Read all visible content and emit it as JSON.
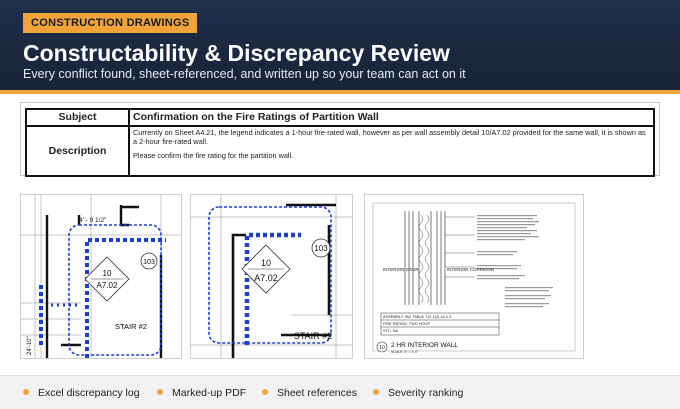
{
  "header": {
    "tag": "CONSTRUCTION DRAWINGS",
    "title": "Constructability & Discrepancy Review",
    "subtitle": "Every conflict found, sheet-referenced, and written up so your team can act on it"
  },
  "discrepancy": {
    "subject_label": "Subject",
    "subject_value": "Confirmation on the Fire Ratings of Partition Wall",
    "description_label": "Description",
    "description_line1": "Currently on Sheet A4.21, the legend indicates a 1-hour fire-rated wall, however as per wall assembly detail 10/A7.02 provided for the same wall, it is shown as a 2-hour fire-rated wall.",
    "description_line2": "Please confirm the fire rating for the partition wall."
  },
  "drawings": {
    "plan1": {
      "tag_num": "10",
      "tag_sheet": "A7.02",
      "room": "103",
      "stair": "STAIR #2",
      "dim": "4' - 9 1/2\"",
      "dim_side": "24'-10\""
    },
    "plan2": {
      "tag_num": "10",
      "tag_sheet": "A7.02",
      "room": "103",
      "stair": "STAIR #2"
    },
    "detail": {
      "left_label": "INTERIOR STAIR",
      "right_label": "INTERIOR CORRIDOR",
      "table_row1": "ASSEMBLY:   IBC TABLE 721.1(2) 14-1.3",
      "table_row2": "FIRE RATING: TWO HOUR",
      "table_row3": "STC: NA",
      "detail_num": "10",
      "detail_title": "2 HR INTERIOR WALL",
      "scale": "SCALE: 3\" = 1'-0\""
    }
  },
  "features": [
    "Excel discrepancy log",
    "Marked-up PDF",
    "Sheet references",
    "Severity ranking"
  ],
  "colors": {
    "accent": "#f2a33a",
    "header_bg": "#1f2f4a",
    "markup": "#1c3fd1"
  }
}
